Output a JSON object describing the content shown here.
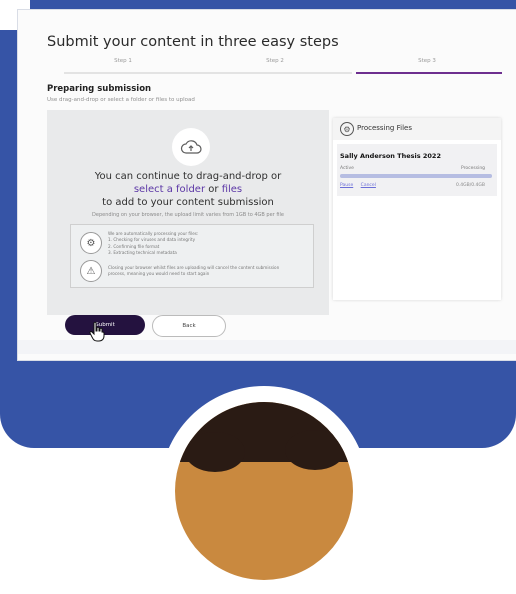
{
  "page": {
    "title": "Submit your content in three easy steps"
  },
  "steps": [
    {
      "label": "Step 1"
    },
    {
      "label": "Step 2"
    },
    {
      "label": "Step 3"
    }
  ],
  "preparing": {
    "title": "Preparing submission",
    "subtitle": "Use drag-and-drop or select a folder or files to upload"
  },
  "dropzone": {
    "line1": "You can continue to drag-and-drop or",
    "line2_link_folder": "select a folder",
    "line2_or": "or",
    "line2_link_files": "files",
    "line3": "to add to your content submission",
    "limit": "Depending on your browser, the upload limit varies from 1GB to 4GB per file"
  },
  "info": {
    "processing_title": "We are automatically processing your files:",
    "processing_items": [
      "1. Checking for viruses and data integrity",
      "2. Confirming file format",
      "3. Extracting technical metadata"
    ],
    "warning_line1": "Closing your browser whilst files are uploading will cancel the content submission",
    "warning_line2": "process, meaning you would need to start again"
  },
  "panel": {
    "title": "Processing Files",
    "file": {
      "name": "Sally Anderson Thesis 2022",
      "status_left": "Active",
      "status_right": "Processing",
      "progress": 1.0,
      "link_pause": "Pause",
      "link_cancel": "Cancel",
      "size": "0.4GB/0.4GB"
    }
  },
  "buttons": {
    "submit": "Submit",
    "back": "Back"
  },
  "colors": {
    "accent_purple": "#6d2f8f",
    "submit_bg": "#24123f",
    "frame_blue": "#3654a6"
  }
}
